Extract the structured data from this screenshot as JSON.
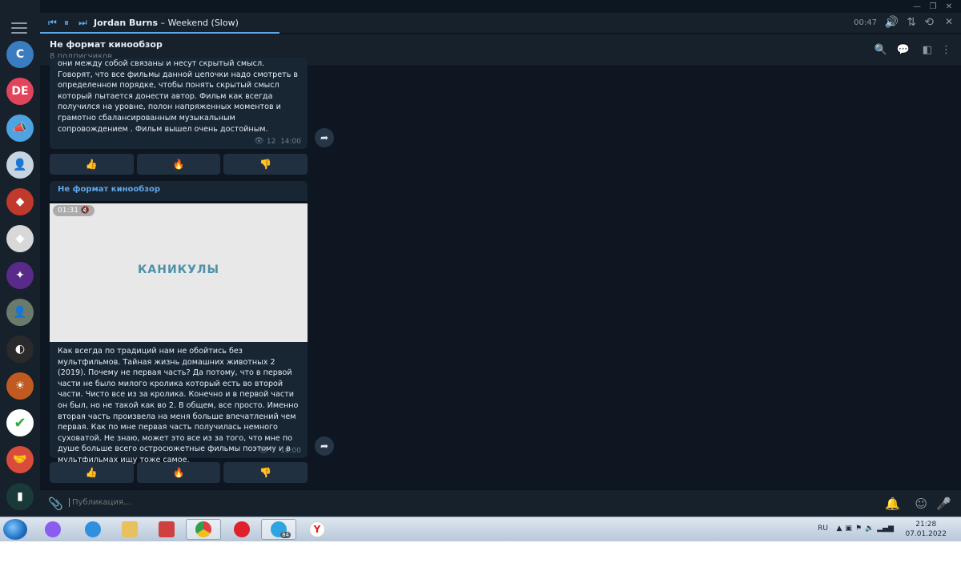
{
  "player": {
    "artist": "Jordan Burns",
    "separator": " – ",
    "track": "Weekend (Slow)",
    "time": "00:47",
    "progress": 0.26
  },
  "header": {
    "title": "Не формат кинообзор",
    "subtitle": "8 подписчиков"
  },
  "sidebar": {
    "avatars": [
      {
        "label": "C",
        "color": "#3a7cc0"
      },
      {
        "label": "DE",
        "color": "#e0455b"
      },
      {
        "label": "",
        "color": "#4ea3e0",
        "icon": "megaphone-icon"
      },
      {
        "label": "",
        "color": "#c8d4e0",
        "icon": "person-icon"
      },
      {
        "label": "",
        "color": "#c0392b",
        "icon": "logo-icon"
      },
      {
        "label": "",
        "color": "#d8d8d8",
        "icon": "logo-icon"
      },
      {
        "label": "",
        "color": "#5a2a8a",
        "icon": "neon-icon"
      },
      {
        "label": "",
        "color": "#6b7b6b",
        "icon": "person-icon"
      },
      {
        "label": "",
        "color": "#2a2a2a",
        "icon": "dark-icon"
      },
      {
        "label": "",
        "color": "#c05a20",
        "icon": "sunset-icon"
      },
      {
        "label": "",
        "color": "#ffffff",
        "icon": "check-icon"
      },
      {
        "label": "",
        "color": "#d94c3c",
        "icon": "handshake-icon"
      },
      {
        "label": "",
        "color": "#1a3a3a",
        "icon": "book-icon"
      }
    ]
  },
  "messages": [
    {
      "text": "они между собой связаны и несут скрытый смысл. Говорят, что все фильмы данной цепочки надо смотреть в определенном порядке, чтобы понять скрытый смысл который пытается донести автор. Фильм как всегда получился на уровне, полон напряженных моментов и грамотно сбалансированным музыкальным сопровождением . Фильм вышел очень достойным.",
      "views": "12",
      "time": "14:00",
      "reactions": [
        "👍",
        "🔥",
        "👎"
      ]
    },
    {
      "channel": "Не формат кинообзор",
      "video_badge": "01:31",
      "video_title": "КАНИКУЛЫ",
      "text": "Как всегда по традиций нам не обойтись без мультфильмов. Тайная жизнь домашних животных 2 (2019). Почему не первая часть? Да потому, что в первой части не было милого кролика который есть во второй части. Чисто все из за кролика. Конечно и в первой части он был, но не такой как во 2. В общем, все просто. Именно вторая часть произвела на меня больше впечатлений чем первая. Как по мне первая часть получилась немного суховатой. Не знаю, может это все из за того, что мне по душе больше всего остросюжетные фильмы поэтому и в мультфильмах ищу тоже самое.",
      "views": "7",
      "time": "18:00",
      "reactions": [
        "👍",
        "🔥",
        "👎"
      ]
    }
  ],
  "composer": {
    "placeholder": "Публикация..."
  },
  "taskbar": {
    "lang": "RU",
    "clock_time": "21:28",
    "clock_date": "07.01.2022",
    "telegram_badge": "84"
  }
}
